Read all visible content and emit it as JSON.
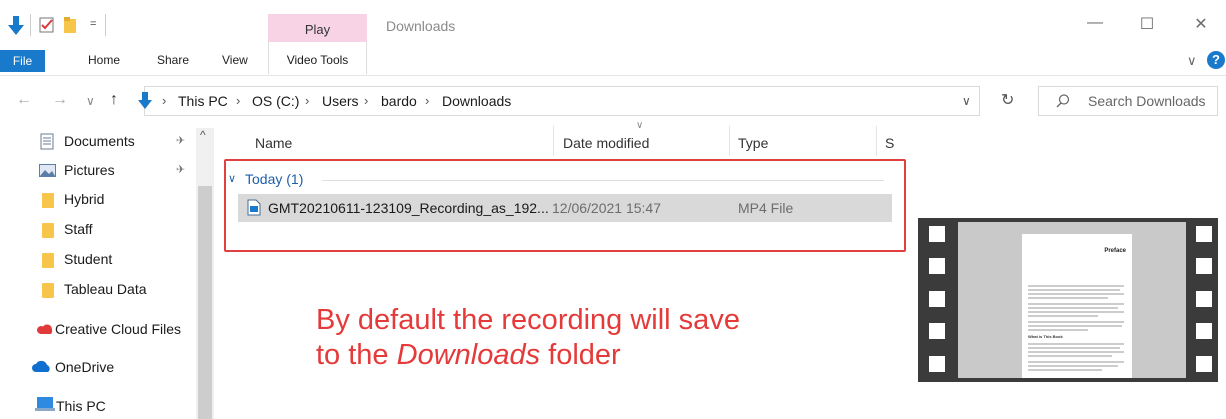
{
  "window": {
    "title": "Downloads",
    "context_tab": "Play",
    "minimize": "—",
    "maximize": "☐",
    "close": "✕",
    "qat_dropdown": "=",
    "ribbon_toggle": "∨",
    "help": "?"
  },
  "ribbon": {
    "tabs": [
      "File",
      "Home",
      "Share",
      "View",
      "Video Tools"
    ]
  },
  "nav": {
    "back": "←",
    "forward": "→",
    "recent": "∨",
    "up": "↑",
    "breadcrumb": [
      "This PC",
      "OS (C:)",
      "Users",
      "bardo",
      "Downloads"
    ],
    "dropdown": "∨",
    "refresh": "↻",
    "search_placeholder": "Search Downloads"
  },
  "sidebar": {
    "pin": "✈",
    "items": [
      {
        "label": "Documents",
        "icon": "documents-icon",
        "pinned": true
      },
      {
        "label": "Pictures",
        "icon": "pictures-icon",
        "pinned": true
      },
      {
        "label": "Hybrid",
        "icon": "folder-icon"
      },
      {
        "label": "Staff",
        "icon": "folder-icon"
      },
      {
        "label": "Student",
        "icon": "folder-icon"
      },
      {
        "label": "Tableau Data",
        "icon": "folder-icon"
      },
      {
        "label": "Creative Cloud Files",
        "icon": "creative-cloud-icon"
      },
      {
        "label": "OneDrive",
        "icon": "onedrive-icon"
      },
      {
        "label": "This PC",
        "icon": "computer-icon"
      }
    ]
  },
  "columns": [
    "Name",
    "Date modified",
    "Type",
    "S"
  ],
  "group": {
    "label": "Today (1)"
  },
  "files": [
    {
      "name": "GMT20210611-123109_Recording_as_192...",
      "date": "12/06/2021 15:47",
      "type": "MP4 File"
    }
  ],
  "annotation": {
    "line1": "By default the recording will save",
    "line2_prefix": "to the ",
    "line2_italic": "Downloads",
    "line2_suffix": " folder"
  },
  "preview": {
    "doc_heading": "Preface",
    "doc_subheading": "What is This Book"
  },
  "colors": {
    "accent": "#1979ca",
    "play_tab": "#f8d3e6",
    "highlight": "#e04040",
    "selection": "#d9d9d9"
  }
}
